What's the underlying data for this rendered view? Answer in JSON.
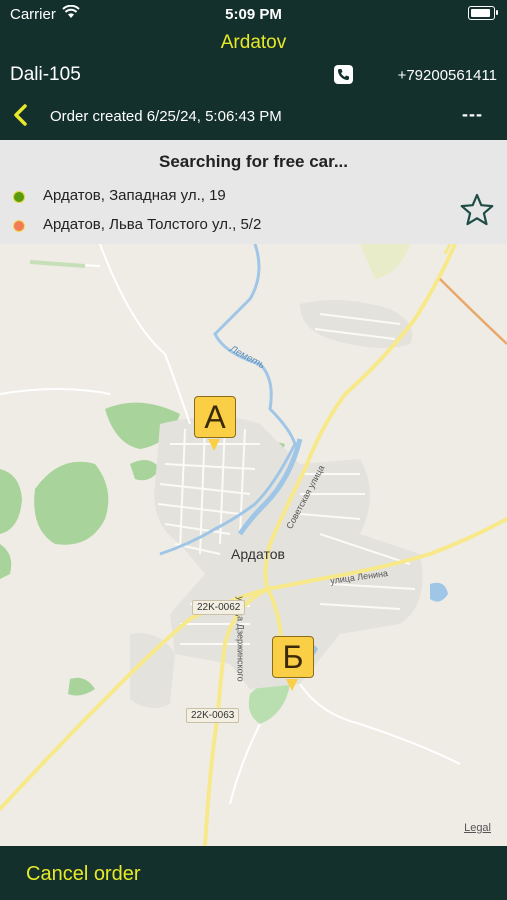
{
  "status_bar": {
    "carrier": "Carrier",
    "time": "5:09 PM"
  },
  "header": {
    "city": "Ardatov",
    "order_number": "Dali-105",
    "phone": "+79200561411",
    "order_created": "Order created 6/25/24, 5:06:43 PM",
    "price": "---"
  },
  "route": {
    "status": "Searching for free car...",
    "from": "Ардатов, Западная ул., 19",
    "to": "Ардатов, Льва Толстого ул., 5/2"
  },
  "map": {
    "town_label": "Ардатов",
    "river_label": "Леметь",
    "street_sovetskaya": "Советская улица",
    "street_lenina": "улица Ленина",
    "street_dzerzh": "улица Дзержинского",
    "road_1": "22K-0062",
    "road_2": "22K-0063",
    "pin_a": "А",
    "pin_b": "Б",
    "legal": "Legal"
  },
  "footer": {
    "cancel_label": "Cancel order"
  },
  "colors": {
    "header_bg": "#13302c",
    "accent_yellow": "#e8e82a",
    "pin": "#fbcf45"
  }
}
